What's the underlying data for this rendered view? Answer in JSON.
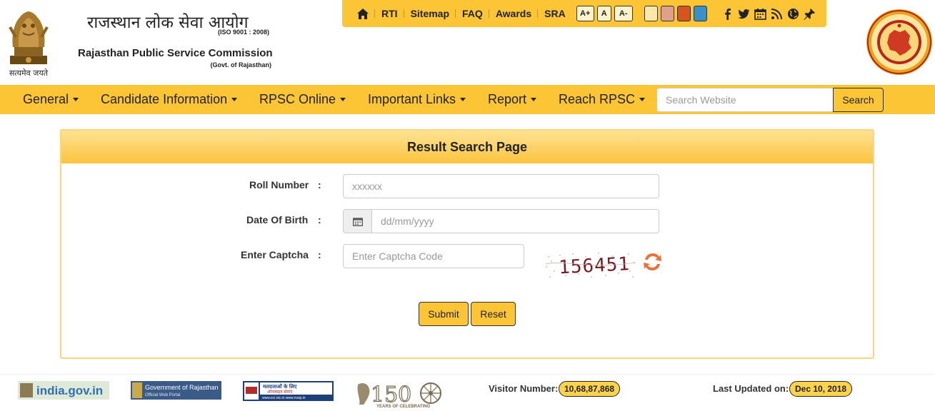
{
  "header": {
    "emblem_caption": "सत्यमेव जयते",
    "title_hindi": "राजस्थान लोक सेवा आयोग",
    "iso": "(ISO 9001 : 2008)",
    "title_english": "Rajasthan Public Service Commission",
    "govt": "(Govt. of Rajasthan)"
  },
  "topbar": {
    "links": [
      "RTI",
      "Sitemap",
      "FAQ",
      "Awards",
      "SRA"
    ],
    "font_sizes": [
      "A+",
      "A",
      "A-"
    ],
    "themes": [
      "#fde9a7",
      "#e0a08e",
      "#d9531e",
      "#3a8fc9"
    ],
    "social_icons": [
      "facebook-icon",
      "twitter-icon",
      "calendar-icon",
      "rss-icon",
      "globe-icon",
      "pin-icon"
    ],
    "accent": "#fcc535"
  },
  "nav": {
    "items": [
      "General",
      "Candidate Information",
      "RPSC Online",
      "Important Links",
      "Report",
      "Reach RPSC"
    ],
    "search_placeholder": "Search Website",
    "search_button": "Search"
  },
  "form": {
    "title": "Result Search Page",
    "colon": ":",
    "roll_label": "Roll Number",
    "roll_placeholder": "xxxxxx",
    "dob_label": "Date Of Birth",
    "dob_placeholder": "dd/mm/yyyy",
    "captcha_label": "Enter Captcha",
    "captcha_placeholder": "Enter Captcha Code",
    "captcha_code": "156451",
    "submit": "Submit",
    "reset": "Reset"
  },
  "footer": {
    "india_gov": "india.gov.in",
    "gov_raj": "Government of Rajasthan",
    "gov_raj_sub": "Official Web Portal",
    "voter_hi": "मतदाताओं के लिए",
    "voter_hi2": "ऑनलाइन सेवाएं",
    "voter_url": "www.eci.nic.in  www.nvsp.in",
    "years_num": "150",
    "years_text": "YEARS OF CELEBRATING",
    "visitor_label": "Visitor Number:",
    "visitor_number": "10,68,87,868",
    "updated_label": "Last Updated on:",
    "updated_date": "Dec 10, 2018"
  }
}
